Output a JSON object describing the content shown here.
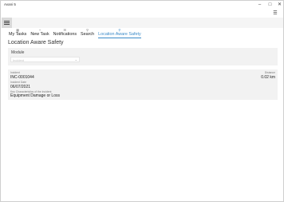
{
  "window": {
    "title": "Avani 5",
    "controls": [
      "–",
      "□",
      "✕"
    ]
  },
  "header": {
    "menu_icon": "hamburger-icon",
    "more_icon": "more-icon"
  },
  "tabs": [
    {
      "label": "My Tasks",
      "icon": "grid-icon",
      "glyph": "▦",
      "active": false
    },
    {
      "label": "New Task",
      "icon": "plus-icon",
      "glyph": "+",
      "active": false
    },
    {
      "label": "Notifications",
      "icon": "mail-icon",
      "glyph": "✉",
      "active": false
    },
    {
      "label": "Search",
      "icon": "search-icon",
      "glyph": "⚲",
      "active": false
    },
    {
      "label": "Location Aware Safety",
      "icon": "location-icon",
      "glyph": "⚲",
      "active": true
    }
  ],
  "page": {
    "title": "Location Aware Safety"
  },
  "module": {
    "label": "Module",
    "placeholder": "Incident"
  },
  "incident": {
    "incident_label": "Incident",
    "incident_value": "INC-0001044",
    "date_label": "Incident Date",
    "date_value": "06/07/2021",
    "type_label": "Key Characteristics of the Incident",
    "type_value": "Equipment Damage or Loss",
    "distance_label": "Distance",
    "distance_value": "0.02 km"
  },
  "colors": {
    "accent": "#3a8ac8",
    "card_bg": "#f2f2f2",
    "nav_button_bg": "#d9d9d9"
  }
}
